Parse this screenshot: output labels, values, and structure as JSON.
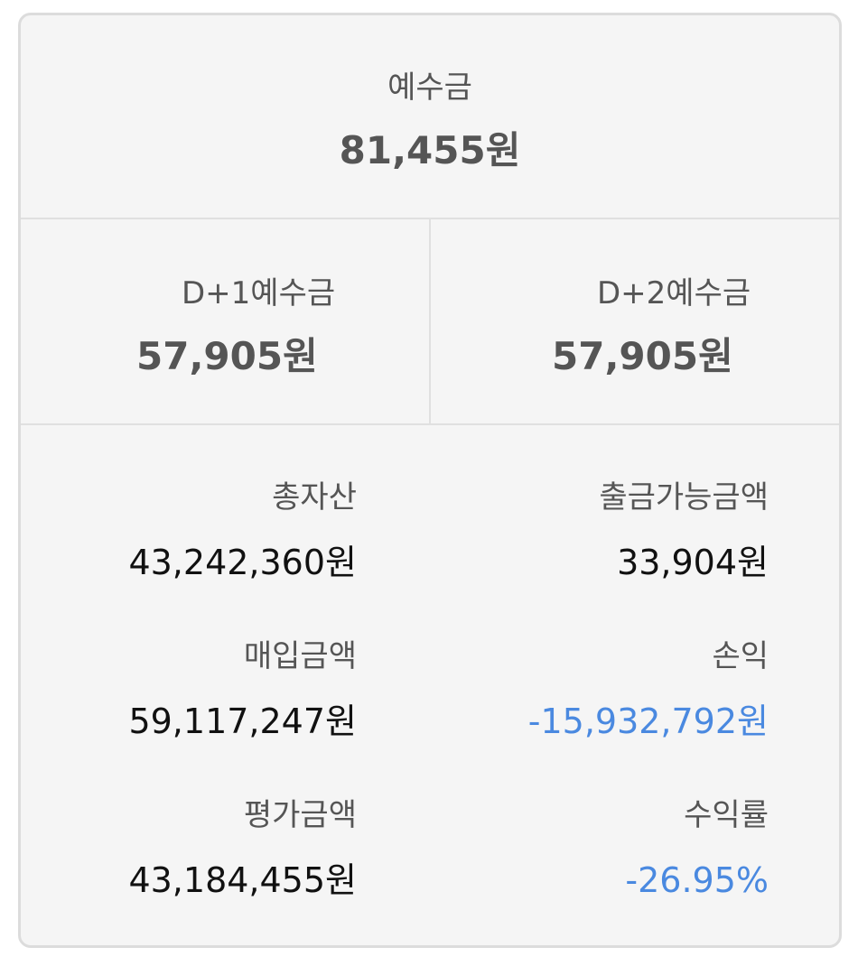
{
  "deposit": {
    "label": "예수금",
    "value": "81,455원"
  },
  "d1_deposit": {
    "label": "D+1예수금",
    "value": "57,905원"
  },
  "d2_deposit": {
    "label": "D+2예수금",
    "value": "57,905원"
  },
  "summary": {
    "total_assets": {
      "label": "총자산",
      "value": "43,242,360원"
    },
    "withdrawable": {
      "label": "출금가능금액",
      "value": "33,904원"
    },
    "purchase_amount": {
      "label": "매입금액",
      "value": "59,117,247원"
    },
    "profit_loss": {
      "label": "손익",
      "value": "-15,932,792원"
    },
    "evaluation_amount": {
      "label": "평가금액",
      "value": "43,184,455원"
    },
    "return_rate": {
      "label": "수익률",
      "value": "-26.95%"
    }
  },
  "colors": {
    "negative": "#4a89e0",
    "label": "#555555",
    "value": "#111111",
    "background": "#f5f5f5",
    "border": "#dcdcdc"
  }
}
